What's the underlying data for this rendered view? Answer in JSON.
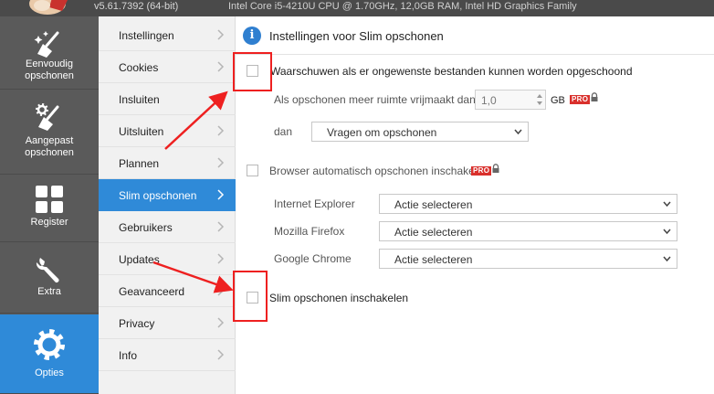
{
  "window": {
    "version": "v5.61.7392 (64-bit)",
    "sysinfo": "Intel Core i5-4210U CPU @ 1.70GHz, 12,0GB RAM, Intel HD Graphics Family"
  },
  "leftnav": {
    "items": [
      {
        "label": "Eenvoudig opschonen",
        "icon": "broom-sparkle-icon"
      },
      {
        "label": "Aangepast opschonen",
        "icon": "broom-gear-icon"
      },
      {
        "label": "Register",
        "icon": "grid-icon"
      },
      {
        "label": "Extra",
        "icon": "wrench-icon"
      },
      {
        "label": "Opties",
        "icon": "gear-icon"
      }
    ],
    "active_index": 4
  },
  "submenu": {
    "items": [
      {
        "label": "Instellingen"
      },
      {
        "label": "Cookies"
      },
      {
        "label": "Insluiten"
      },
      {
        "label": "Uitsluiten"
      },
      {
        "label": "Plannen"
      },
      {
        "label": "Slim opschonen"
      },
      {
        "label": "Gebruikers"
      },
      {
        "label": "Updates"
      },
      {
        "label": "Geavanceerd"
      },
      {
        "label": "Privacy"
      },
      {
        "label": "Info"
      }
    ],
    "active_index": 5
  },
  "content": {
    "title": "Instellingen voor Slim opschonen",
    "warn_checkbox": {
      "label": "Waarschuwen als er ongewenste bestanden kunnen worden opgeschoond",
      "checked": false
    },
    "space_label": "Als opschonen meer ruimte vrijmaakt dan",
    "space_value": "1,0",
    "space_unit": "GB",
    "pro_badge": "PRO",
    "then_label": "dan",
    "then_value": "Vragen om opschonen",
    "browser_checkbox": {
      "label": "Browser automatisch opschonen inschakelen",
      "checked": false
    },
    "browsers": [
      {
        "name": "Internet Explorer",
        "value": "Actie selecteren"
      },
      {
        "name": "Mozilla Firefox",
        "value": "Actie selecteren"
      },
      {
        "name": "Google Chrome",
        "value": "Actie selecteren"
      }
    ],
    "smart_checkbox": {
      "label": "Slim opschonen inschakelen",
      "checked": false
    }
  },
  "colors": {
    "accent": "#2f8ad8",
    "nav_bg": "#5a5a5a",
    "pro_badge": "#d9302c",
    "annotation_red": "#ee2020"
  }
}
